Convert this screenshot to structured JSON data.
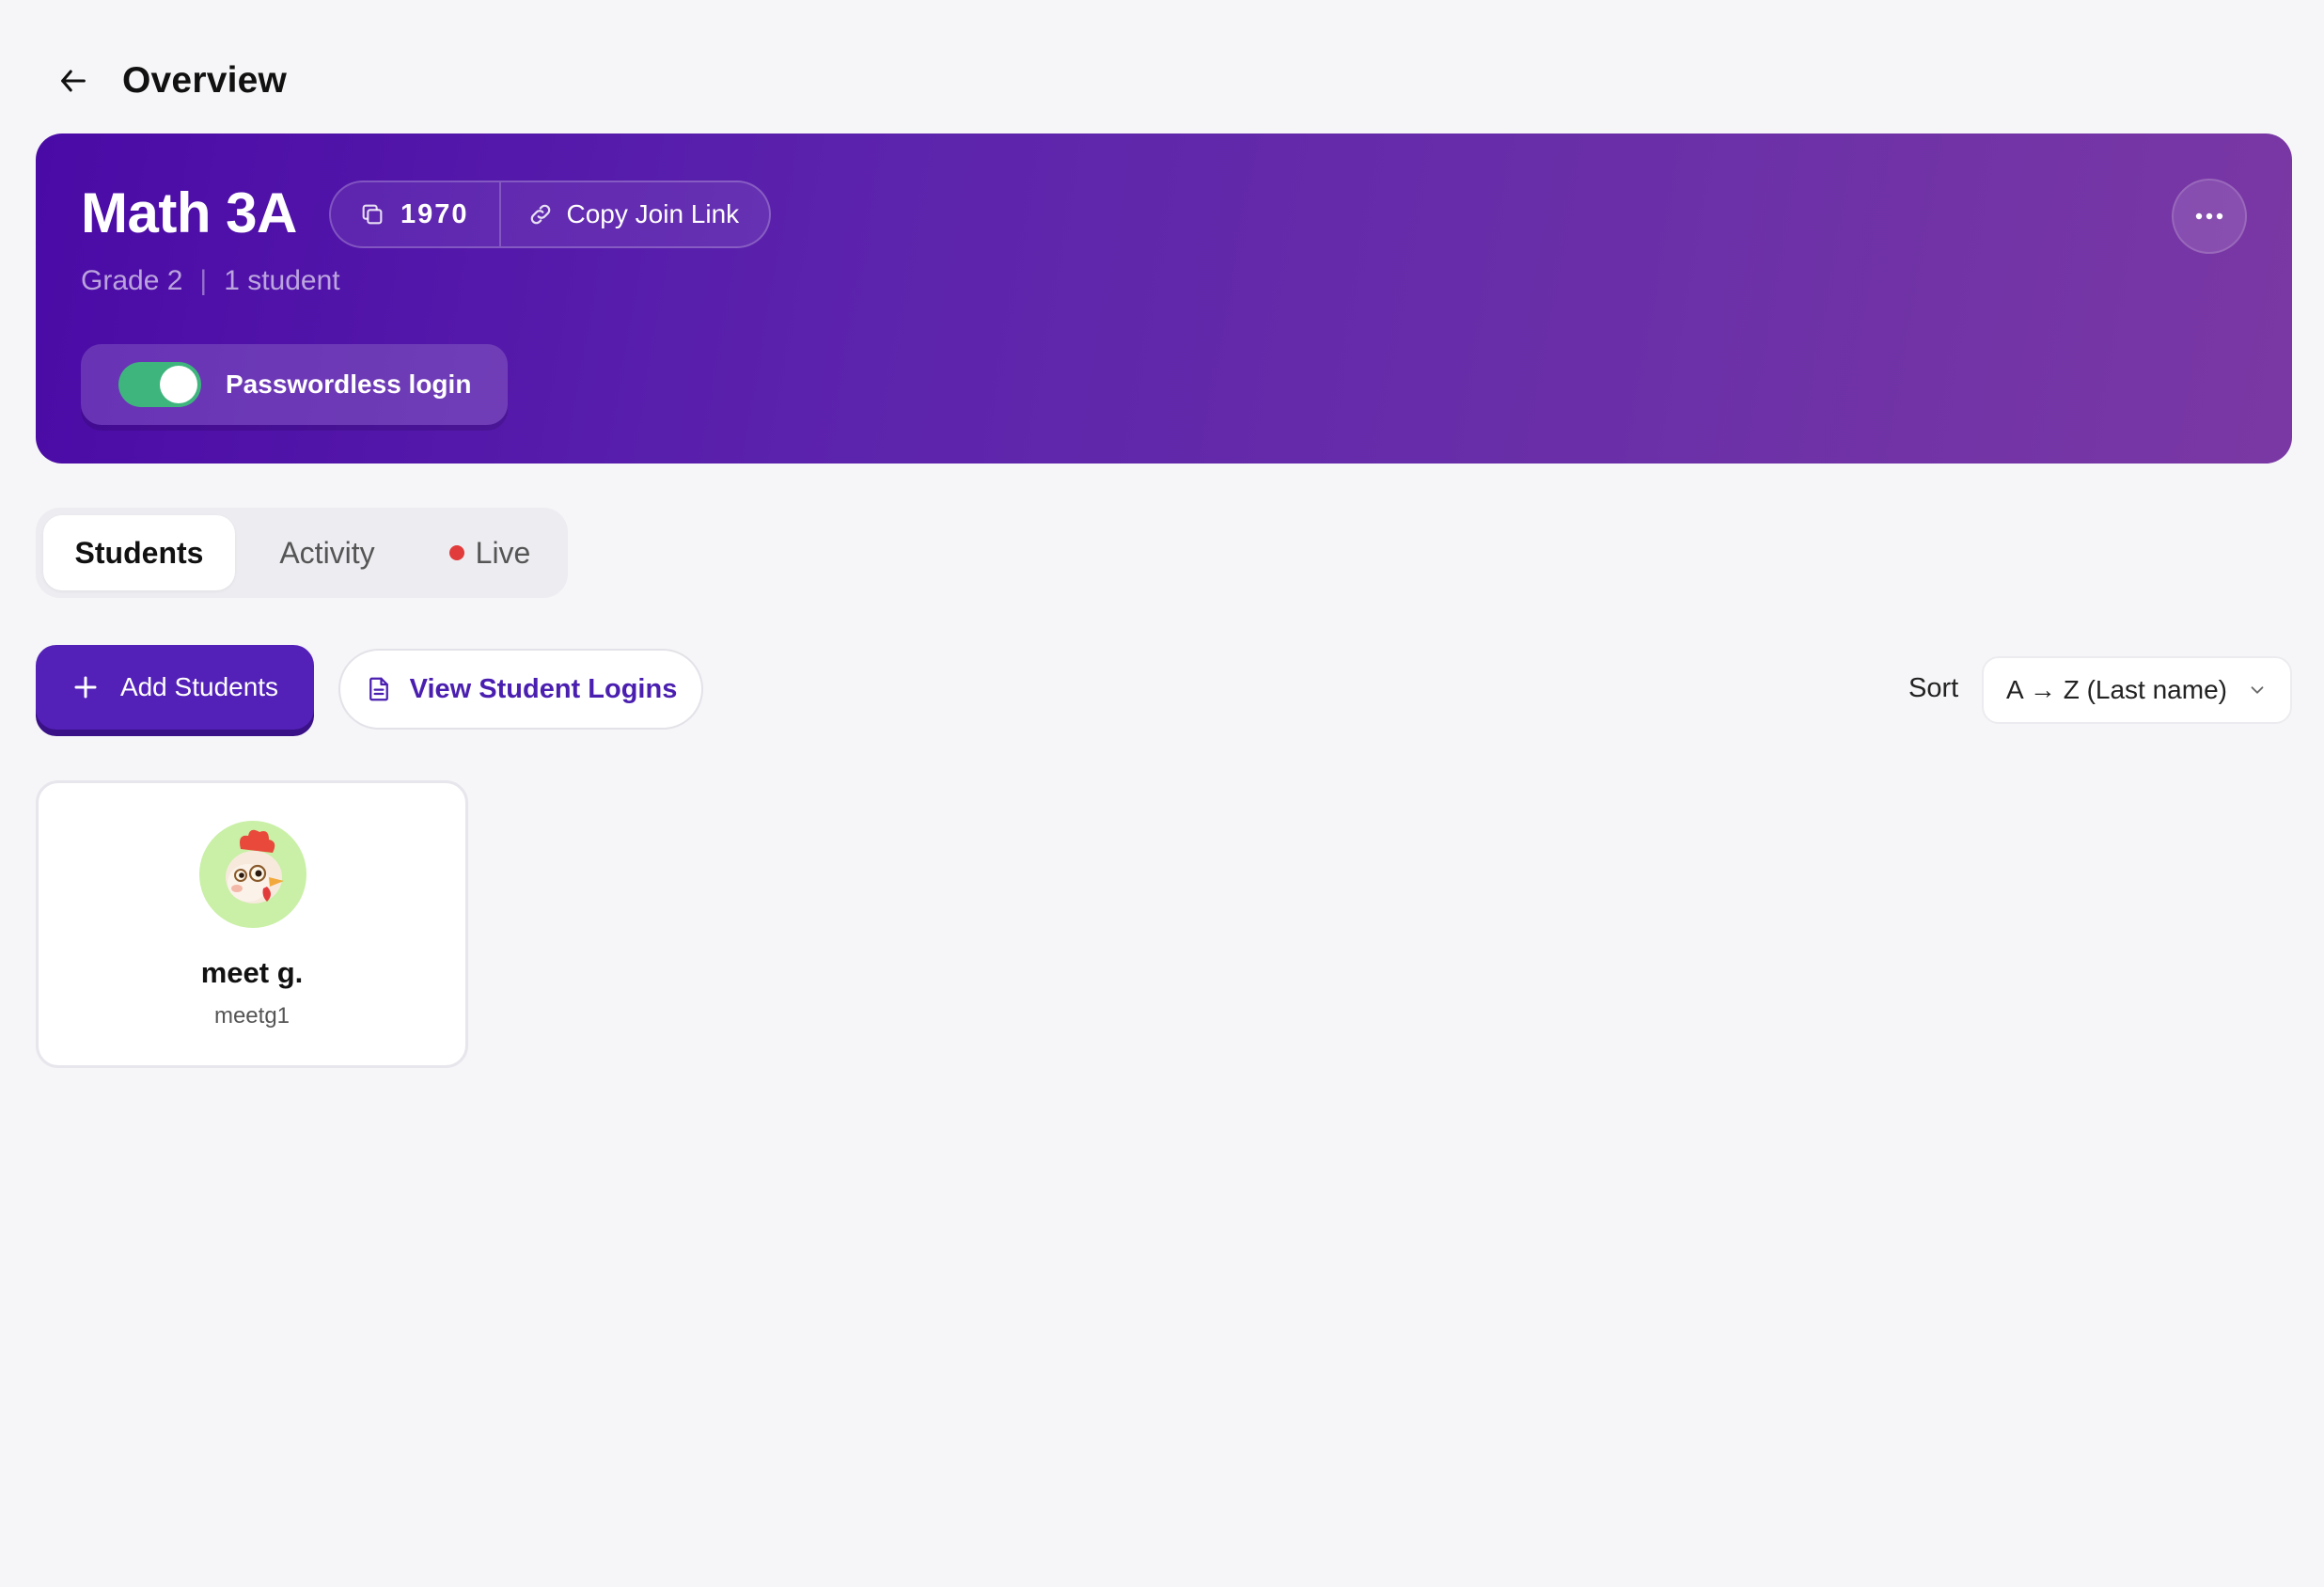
{
  "header": {
    "title": "Overview",
    "back_icon": "arrow-left-icon"
  },
  "class": {
    "name": "Math 3A",
    "code": "1970",
    "copy_link_label": "Copy Join Link",
    "grade": "Grade 2",
    "separator": "|",
    "student_count": "1 student",
    "passwordless_label": "Passwordless login",
    "passwordless_enabled": true,
    "colors": {
      "banner_start": "#4a0aa6",
      "banner_end": "#7a38a4",
      "toggle_on": "#3fb57e"
    }
  },
  "tabs": [
    {
      "label": "Students",
      "active": true
    },
    {
      "label": "Activity",
      "active": false
    },
    {
      "label": "Live",
      "active": false,
      "indicator_color": "#e23b3b"
    }
  ],
  "actions": {
    "add_students_label": "Add Students",
    "view_logins_label": "View Student Logins",
    "sort_label": "Sort",
    "sort_value": "A → Z (Last name)",
    "primary_color": "#5321b8"
  },
  "students": [
    {
      "name": "meet g.",
      "username": "meetg1",
      "avatar": "chicken-avatar"
    }
  ]
}
